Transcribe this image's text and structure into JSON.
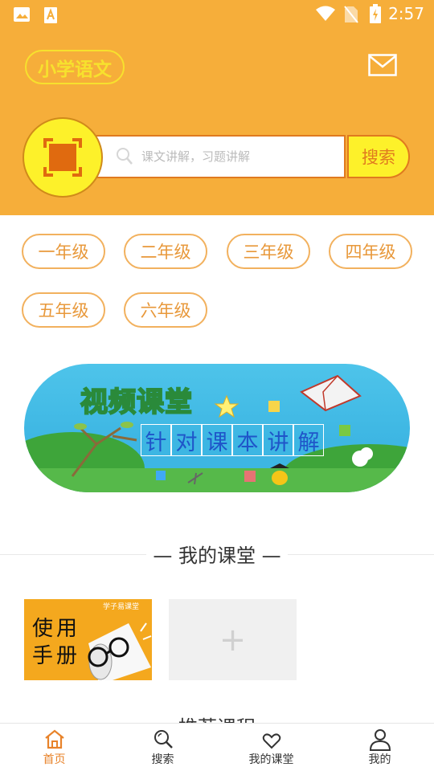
{
  "status_bar": {
    "time": "2:57"
  },
  "header": {
    "app_title": "小学语文",
    "search_placeholder": "课文讲解，习题讲解",
    "search_button": "搜索"
  },
  "grades": [
    "一年级",
    "二年级",
    "三年级",
    "四年级",
    "五年级",
    "六年级"
  ],
  "banner": {
    "title": "视频课堂",
    "subtitle_chars": [
      "针",
      "对",
      "课",
      "本",
      "讲",
      "解"
    ]
  },
  "my_classroom": {
    "title": "— 我的课堂 —",
    "manual_card": {
      "line1": "使用",
      "line2": "手册",
      "tag": "学子易课堂"
    },
    "add_symbol": "+"
  },
  "recommended_partial": "推荐课程",
  "bottom_nav": [
    {
      "label": "首页",
      "icon": "home-icon",
      "active": true
    },
    {
      "label": "搜索",
      "icon": "search-icon",
      "active": false
    },
    {
      "label": "我的课堂",
      "icon": "heart-icon",
      "active": false
    },
    {
      "label": "我的",
      "icon": "person-icon",
      "active": false
    }
  ],
  "colors": {
    "header_bg": "#F6AE3A",
    "accent": "#E8832A",
    "yellow": "#FDF12A"
  }
}
